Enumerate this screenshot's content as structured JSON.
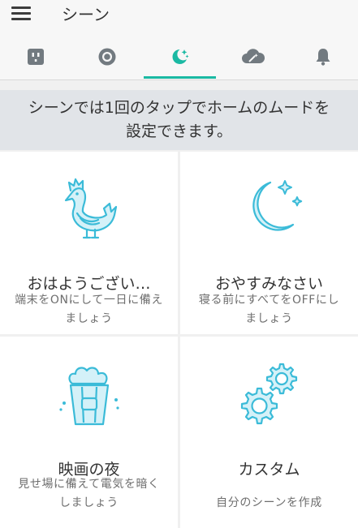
{
  "header": {
    "title": "シーン",
    "menu_icon": "hamburger-menu-icon"
  },
  "tabs": [
    {
      "icon": "smart-plug-icon",
      "active": false
    },
    {
      "icon": "camera-lens-icon",
      "active": false
    },
    {
      "icon": "moon-stars-icon",
      "active": true
    },
    {
      "icon": "cloud-magic-wand-icon",
      "active": false
    },
    {
      "icon": "bell-icon",
      "active": false
    }
  ],
  "banner": {
    "line1": "シーンでは1回のタップでホームのムードを",
    "line2": "設定できます。"
  },
  "scenes": [
    {
      "icon": "rooster-icon",
      "title": "おはようござい…",
      "desc_line1": "端末をONにして一日に備え",
      "desc_line2": "ましょう"
    },
    {
      "icon": "moon-stars-icon",
      "title": "おやすみなさい",
      "desc_line1": "寝る前にすべてをOFFにし",
      "desc_line2": "ましょう"
    },
    {
      "icon": "popcorn-icon",
      "title": "映画の夜",
      "desc_line1": "見せ場に備えて電気を暗く",
      "desc_line2": "しましょう"
    },
    {
      "icon": "gears-icon",
      "title": "カスタム",
      "desc_line1": "自分のシーンを作成",
      "desc_line2": ""
    }
  ],
  "colors": {
    "accent": "#1ab9a3",
    "icon_stroke": "#3bbbd8",
    "icon_fill": "#d4f1f8",
    "banner_bg": "#e1e4e8"
  }
}
